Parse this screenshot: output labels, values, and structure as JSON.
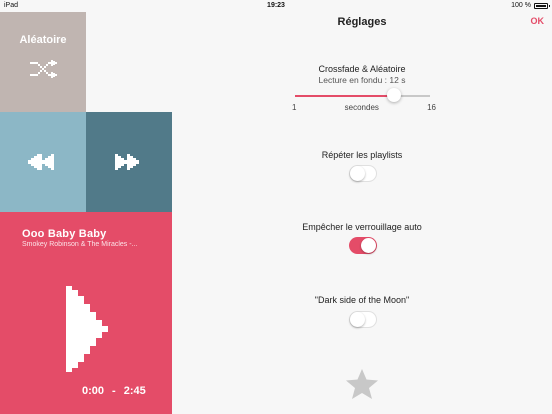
{
  "status_bar": {
    "device": "iPad",
    "time": "19:23",
    "battery": "100 %"
  },
  "left_panel": {
    "shuffle": {
      "label": "Aléatoire",
      "icon": "shuffle-icon"
    },
    "previous": {
      "icon": "rewind-icon"
    },
    "next": {
      "icon": "fast-forward-icon"
    },
    "now_playing": {
      "title": "Ooo Baby Baby",
      "artist": "Smokey Robinson & The Miracles -...",
      "elapsed": "0:00",
      "separator": "-",
      "duration": "2:45",
      "icon": "play-icon"
    }
  },
  "settings": {
    "title": "Réglages",
    "ok_label": "OK",
    "crossfade": {
      "label": "Crossfade & Aléatoire",
      "sublabel": "Lecture en fondu : 12 s",
      "min": "1",
      "unit": "secondes",
      "max": "16",
      "value": 12
    },
    "repeat_playlists": {
      "label": "Répéter les playlists",
      "on": false
    },
    "prevent_autolock": {
      "label": "Empêcher le verrouillage auto",
      "on": true
    },
    "dark_side": {
      "label": "\"Dark side of the Moon\"",
      "on": false
    },
    "rate_icon": "star-icon"
  },
  "colors": {
    "accent": "#e44c68",
    "shuffle_tile": "#c0b5b1",
    "prev_tile": "#8cb7c6",
    "next_tile": "#517a89",
    "background": "#f7f7f7"
  }
}
